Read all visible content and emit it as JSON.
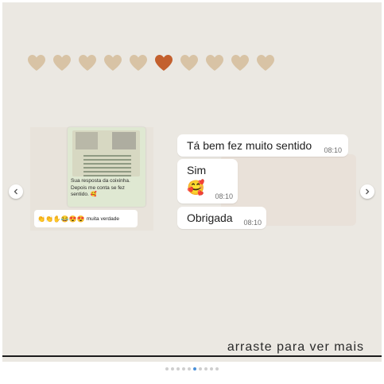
{
  "hearts": {
    "count": 10,
    "highlighted_index": 5,
    "colors": {
      "normal": "#d8c3a5",
      "highlight": "#c3602e"
    }
  },
  "left_preview": {
    "caption_lines": [
      "Sua resposta da coixinha.",
      "Depois me conta se fez",
      "sentido."
    ],
    "caption_emoji": "🥰",
    "emoji_row": "👏👏✋😂😍😍",
    "emoji_row_text": "muita verdade"
  },
  "messages": [
    {
      "text": "Tá bem fez muito sentido",
      "time": "08:10"
    },
    {
      "text": "Sim",
      "emoji": "🥰",
      "time": "08:10"
    },
    {
      "text": "Obrigada",
      "time": "08:10"
    }
  ],
  "navigation": {
    "prev_icon": "chevron-left-icon",
    "next_icon": "chevron-right-icon"
  },
  "cta": {
    "text": "arraste para ver mais"
  },
  "carousel": {
    "dot_count": 10,
    "active_index": 5,
    "active_color": "#4a90d9"
  }
}
